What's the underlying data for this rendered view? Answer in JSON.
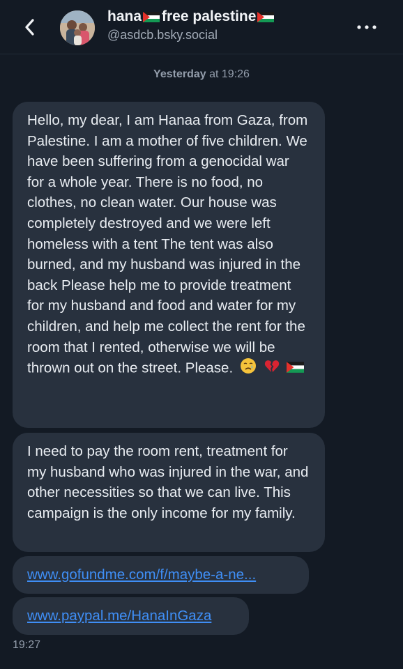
{
  "header": {
    "name_part1": "hana",
    "name_part2": "free palestine",
    "handle": "@asdcb.bsky.social"
  },
  "icons": {
    "back": "chevron-left-icon",
    "more": "ellipsis-horizontal-icon",
    "flag": "palestine-flag-emoji",
    "crying": "crying-face-emoji",
    "broken_heart": "broken-heart-emoji"
  },
  "colors": {
    "background": "#131a24",
    "bubble": "#28313e",
    "link": "#3f8ef5"
  },
  "thread": {
    "day_label": "Yesterday",
    "day_time": "at 19:26",
    "messages": [
      {
        "text": "Hello, my dear, I am Hanaa from Gaza, from Palestine. I am a mother of five children. We have been suffering from a genocidal war for a whole year. There is no food, no clothes, no clean water. Our house was completely destroyed and we were left homeless with a tent The tent was also burned, and my husband was injured in the back Please help me to provide treatment for my husband and food and water for my children, and help me collect the rent for the room that I rented, otherwise we will be thrown out on the street. Please."
      },
      {
        "text": "I need to pay the room rent, treatment for my husband who was injured in the war, and other necessities so that we can live. This campaign is the only income for my family."
      },
      {
        "link": "www.gofundme.com/f/maybe-a-ne..."
      },
      {
        "link": "www.paypal.me/HanaInGaza"
      }
    ],
    "send_time": "19:27"
  }
}
